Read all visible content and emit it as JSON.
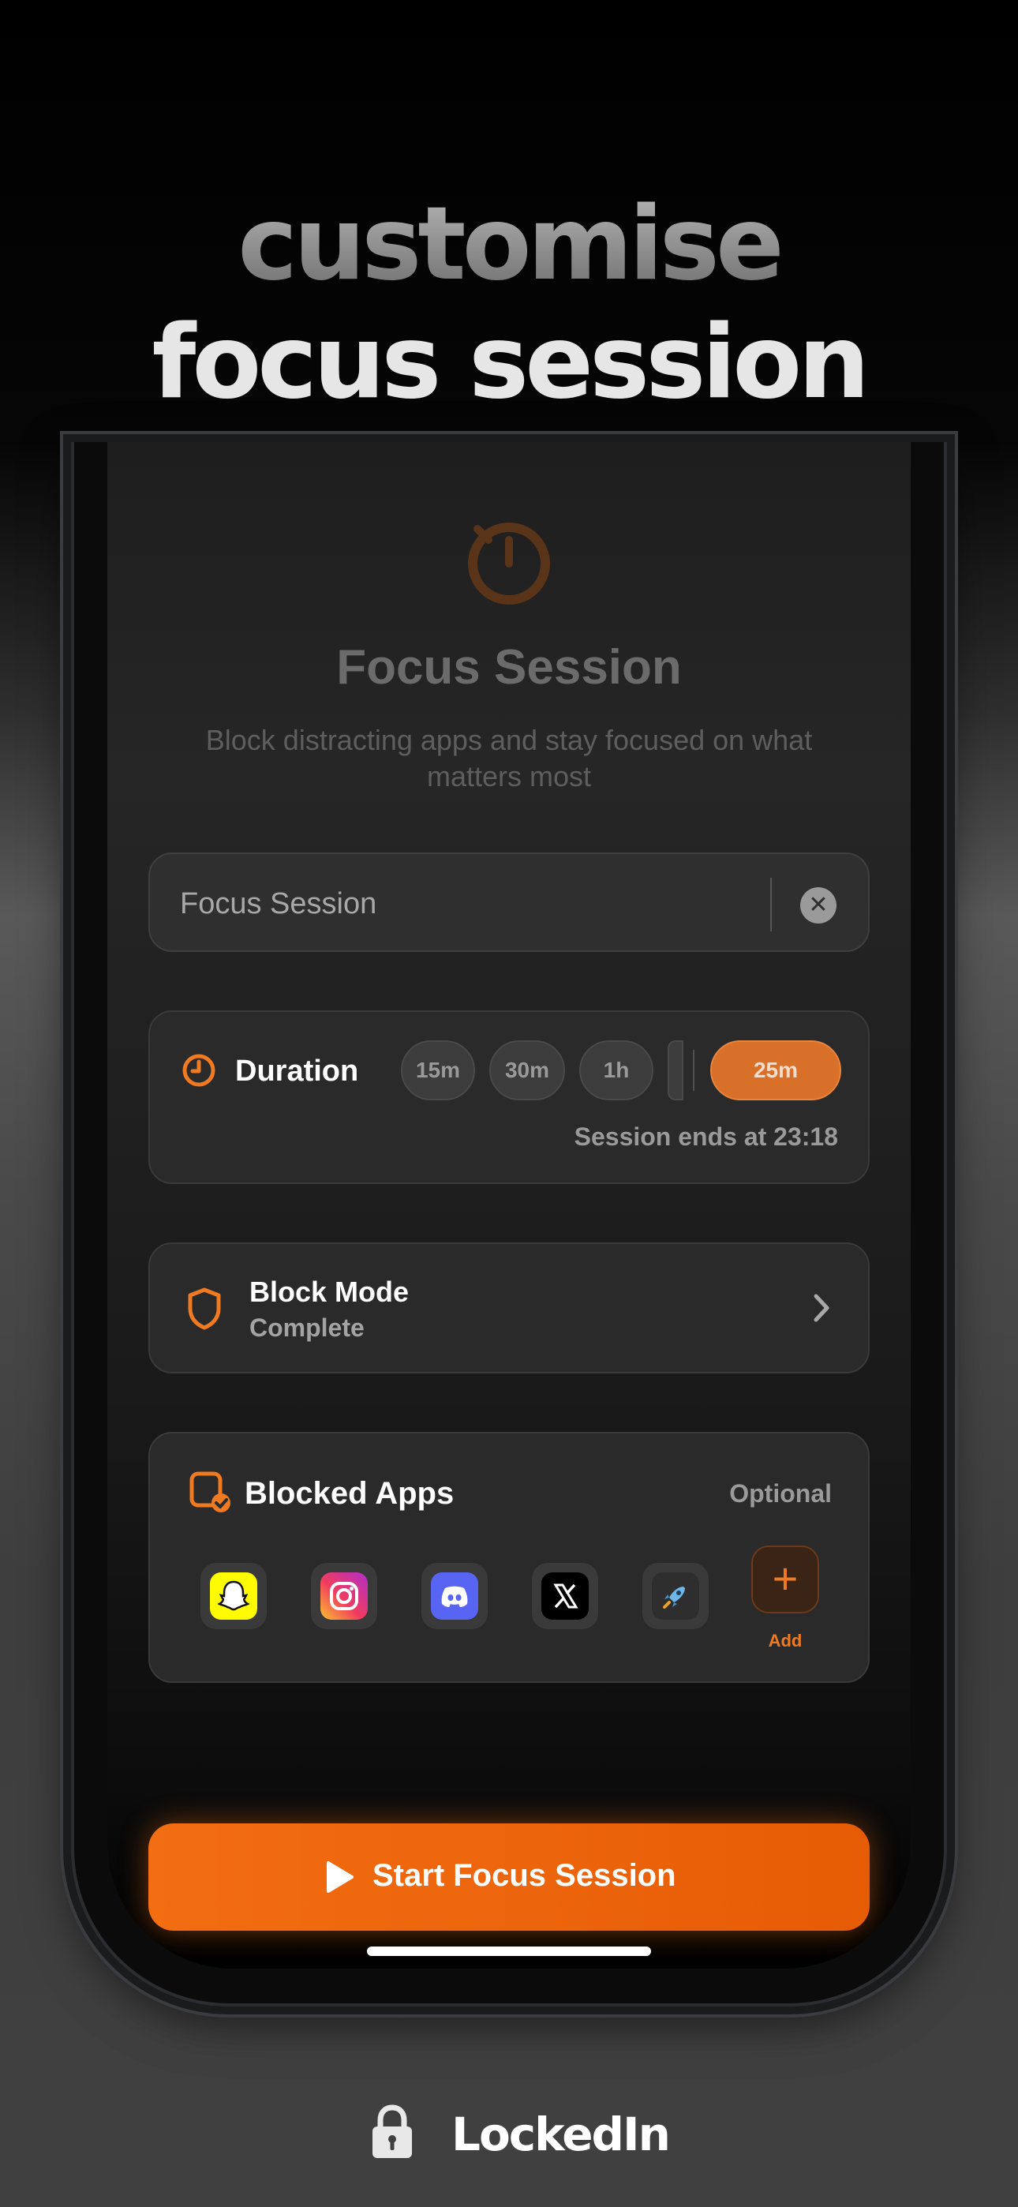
{
  "headline": {
    "line1": "customise",
    "line2": "focus session"
  },
  "screen": {
    "title": "Focus Session",
    "subtitle": "Block distracting apps and stay focused on what matters most",
    "session_name": {
      "value": "Focus Session"
    },
    "duration": {
      "label": "Duration",
      "chips": [
        "15m",
        "30m",
        "1h"
      ],
      "selected": "25m",
      "session_ends": "Session ends at 23:18"
    },
    "block_mode": {
      "title": "Block Mode",
      "value": "Complete"
    },
    "blocked_apps": {
      "title": "Blocked Apps",
      "optional": "Optional",
      "apps": [
        "snapchat-icon",
        "instagram-icon",
        "discord-icon",
        "x-icon",
        "rocket-icon"
      ],
      "add_label": "Add"
    },
    "start_button": "Start Focus Session"
  },
  "brand": {
    "name": "LockedIn"
  },
  "colors": {
    "accent": "#f07a22",
    "button": "#ee6a10"
  }
}
